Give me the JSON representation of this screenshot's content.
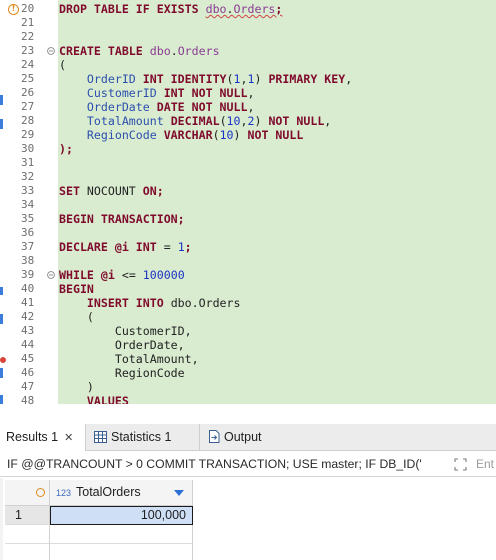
{
  "editor": {
    "line_numbers": [
      "20",
      "21",
      "22",
      "23",
      "24",
      "25",
      "26",
      "27",
      "28",
      "29",
      "30",
      "31",
      "32",
      "33",
      "34",
      "35",
      "36",
      "37",
      "38",
      "39",
      "40",
      "41",
      "42",
      "43",
      "44",
      "45",
      "46",
      "47",
      "48"
    ],
    "lines": [
      [
        {
          "t": "DROP TABLE IF EXISTS ",
          "c": "kw"
        },
        {
          "t": "dbo",
          "c": "sch sq"
        },
        {
          "t": ".",
          "c": "pl sq"
        },
        {
          "t": "Orders",
          "c": "sch sq"
        },
        {
          "t": ";",
          "c": "kw sq"
        }
      ],
      [],
      [],
      [
        {
          "t": "CREATE TABLE ",
          "c": "kw"
        },
        {
          "t": "dbo",
          "c": "sch"
        },
        {
          "t": ".",
          "c": "pl"
        },
        {
          "t": "Orders",
          "c": "sch"
        }
      ],
      [
        {
          "t": "(",
          "c": "pl"
        }
      ],
      [
        {
          "t": "    OrderID ",
          "c": "id"
        },
        {
          "t": "INT IDENTITY",
          "c": "kw"
        },
        {
          "t": "(",
          "c": "pl"
        },
        {
          "t": "1",
          "c": "num"
        },
        {
          "t": ",",
          "c": "pl"
        },
        {
          "t": "1",
          "c": "num"
        },
        {
          "t": ") ",
          "c": "pl"
        },
        {
          "t": "PRIMARY KEY",
          "c": "kw"
        },
        {
          "t": ",",
          "c": "pl"
        }
      ],
      [
        {
          "t": "    CustomerID ",
          "c": "id"
        },
        {
          "t": "INT NOT NULL",
          "c": "kw"
        },
        {
          "t": ",",
          "c": "pl"
        }
      ],
      [
        {
          "t": "    OrderDate ",
          "c": "id"
        },
        {
          "t": "DATE NOT NULL",
          "c": "kw"
        },
        {
          "t": ",",
          "c": "pl"
        }
      ],
      [
        {
          "t": "    TotalAmount ",
          "c": "id"
        },
        {
          "t": "DECIMAL",
          "c": "kw"
        },
        {
          "t": "(",
          "c": "pl"
        },
        {
          "t": "10",
          "c": "num"
        },
        {
          "t": ",",
          "c": "pl"
        },
        {
          "t": "2",
          "c": "num"
        },
        {
          "t": ") ",
          "c": "pl"
        },
        {
          "t": "NOT NULL",
          "c": "kw"
        },
        {
          "t": ",",
          "c": "pl"
        }
      ],
      [
        {
          "t": "    RegionCode ",
          "c": "id"
        },
        {
          "t": "VARCHAR",
          "c": "kw"
        },
        {
          "t": "(",
          "c": "pl"
        },
        {
          "t": "10",
          "c": "num"
        },
        {
          "t": ") ",
          "c": "pl"
        },
        {
          "t": "NOT NULL",
          "c": "kw"
        }
      ],
      [
        {
          "t": ");",
          "c": "kw"
        }
      ],
      [],
      [],
      [
        {
          "t": "SET ",
          "c": "kw"
        },
        {
          "t": "NOCOUNT ",
          "c": "pl"
        },
        {
          "t": "ON;",
          "c": "kw"
        }
      ],
      [],
      [
        {
          "t": "BEGIN TRANSACTION;",
          "c": "kw"
        }
      ],
      [],
      [
        {
          "t": "DECLARE ",
          "c": "kw"
        },
        {
          "t": "@i ",
          "c": "kw"
        },
        {
          "t": "INT ",
          "c": "kw"
        },
        {
          "t": "= ",
          "c": "pl"
        },
        {
          "t": "1",
          "c": "num"
        },
        {
          "t": ";",
          "c": "kw"
        }
      ],
      [],
      [
        {
          "t": "WHILE ",
          "c": "kw"
        },
        {
          "t": "@i ",
          "c": "kw"
        },
        {
          "t": "<= ",
          "c": "pl"
        },
        {
          "t": "100000",
          "c": "num"
        }
      ],
      [
        {
          "t": "BEGIN",
          "c": "kw"
        }
      ],
      [
        {
          "t": "    INSERT INTO ",
          "c": "kw"
        },
        {
          "t": "dbo.Orders",
          "c": "pl"
        }
      ],
      [
        {
          "t": "    (",
          "c": "pl"
        }
      ],
      [
        {
          "t": "        CustomerID,",
          "c": "pl"
        }
      ],
      [
        {
          "t": "        OrderDate,",
          "c": "pl"
        }
      ],
      [
        {
          "t": "        TotalAmount,",
          "c": "pl"
        }
      ],
      [
        {
          "t": "        RegionCode",
          "c": "pl"
        }
      ],
      [
        {
          "t": "    )",
          "c": "pl"
        }
      ],
      [
        {
          "t": "    VALUES",
          "c": "kw"
        }
      ]
    ],
    "fold_lines": [
      3,
      19
    ],
    "error_marker": "!"
  },
  "tabs": {
    "results": {
      "label": "Results 1",
      "close": "✕"
    },
    "statistics": {
      "label": "Statistics 1"
    },
    "output": {
      "label": "Output"
    }
  },
  "query_bar": {
    "text": "IF @@TRANCOUNT > 0 COMMIT TRANSACTION; USE master; IF DB_ID('",
    "filter_hint": "Ent"
  },
  "grid": {
    "column": {
      "type_badge": "123",
      "name": "TotalOrders"
    },
    "rows": [
      {
        "num": "1",
        "value": "100,000"
      }
    ]
  },
  "colors": {
    "code_background": "#d9ecd0",
    "keyword": "#7f0a2b",
    "identifier": "#2c4fad",
    "number": "#1a33c4",
    "schema": "#8a3c92",
    "selection": "#cfe0f6"
  }
}
